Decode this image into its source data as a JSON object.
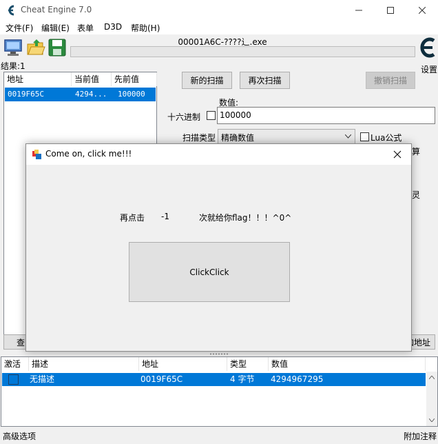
{
  "window": {
    "title": "Cheat Engine 7.0"
  },
  "menu": [
    "文件(F)",
    "编辑(E)",
    "表单",
    "D3D",
    "帮助(H)"
  ],
  "process_name": "00001A6C-????辶.exe",
  "settings_label": "设置",
  "results_label": "结果:1",
  "found_list": {
    "headers": [
      "地址",
      "当前值",
      "先前值"
    ],
    "rows": [
      {
        "address": "0019F65C",
        "current": "4294...",
        "previous": "100000"
      }
    ]
  },
  "scan": {
    "new_scan": "新的扫描",
    "next_scan": "再次扫描",
    "undo_scan": "撤销扫描",
    "value_label": "数值:",
    "hex_label": "十六进制",
    "value": "100000",
    "scan_type_label": "扫描类型",
    "scan_type_value": "精确数值",
    "lua_label": "Lua公式",
    "right_clip_1": "算",
    "right_clip_2": "灵"
  },
  "bottom_clipped": {
    "left_btn": "查",
    "right_btn": "加地址"
  },
  "dialog": {
    "title": "Come on, click me!!!",
    "prefix": "再点击",
    "count": "-1",
    "suffix": "次就给你flag！！！^0^",
    "button": "ClickClick"
  },
  "address_table": {
    "headers": [
      "激活",
      "描述",
      "地址",
      "类型",
      "数值"
    ],
    "rows": [
      {
        "description": "无描述",
        "address": "0019F65C",
        "type": "4 字节",
        "value": "4294967295"
      }
    ]
  },
  "status": {
    "left": "高级选项",
    "right": "附加注释"
  },
  "colors": {
    "selection": "#0078d7",
    "dialog_border": "#8a8a8a"
  }
}
